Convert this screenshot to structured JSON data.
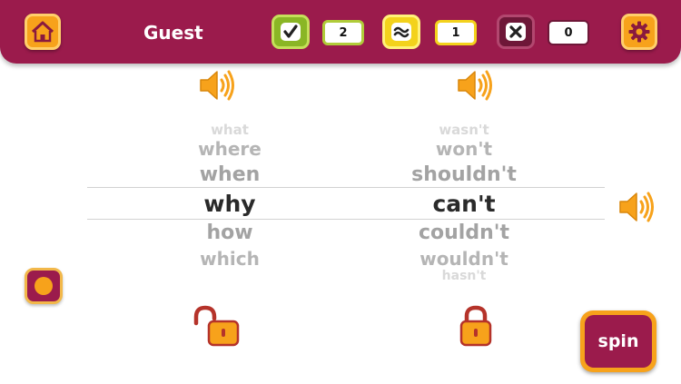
{
  "header": {
    "user_name": "Guest",
    "scores": {
      "correct": "2",
      "approximate": "1",
      "wrong": "0"
    },
    "icons": {
      "home": "home-icon",
      "correct": "checkmark-icon",
      "approximate": "approx-icon",
      "wrong": "x-icon",
      "settings": "gear-icon"
    }
  },
  "wheels": {
    "left": {
      "words_above": [
        "what",
        "where",
        "when"
      ],
      "selected": "why",
      "words_below": [
        "how",
        "which"
      ],
      "lock_state": "unlocked"
    },
    "right": {
      "words_above": [
        "wasn't",
        "won't",
        "shouldn't"
      ],
      "selected": "can't",
      "words_below": [
        "couldn't",
        "wouldn't",
        "hasn't"
      ],
      "lock_state": "locked"
    }
  },
  "controls": {
    "spin_label": "spin",
    "record": "record-icon",
    "speaker": "speaker-icon"
  },
  "colors": {
    "brand": "#9b1b4c",
    "accent": "#f7a21b",
    "correct": "#8ab625",
    "approximate": "#f3d21c",
    "wrong": "#6e1738"
  }
}
